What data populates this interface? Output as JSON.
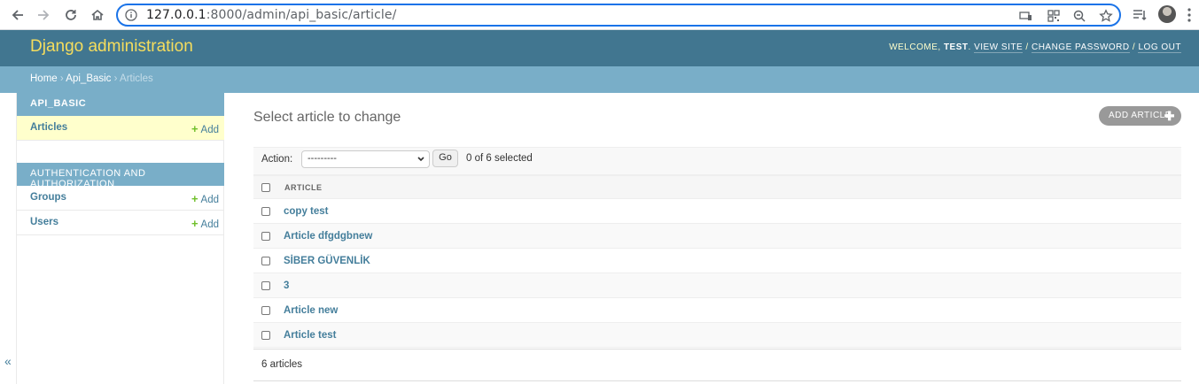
{
  "browser": {
    "url_host": "127.0.0.1",
    "url_rest": ":8000/admin/api_basic/article/"
  },
  "header": {
    "brand": "Django administration",
    "welcome": "WELCOME,",
    "username": "TEST",
    "view_site": "VIEW SITE",
    "change_password": "CHANGE PASSWORD",
    "log_out": "LOG OUT",
    "separator": "/"
  },
  "breadcrumbs": {
    "home": "Home",
    "app": "Api_Basic",
    "current": "Articles",
    "sep": "›"
  },
  "sidebar": {
    "apps": [
      {
        "caption": "API_BASIC",
        "models": [
          {
            "name": "Articles",
            "add": "Add"
          }
        ]
      },
      {
        "caption": "AUTHENTICATION AND AUTHORIZATION",
        "models": [
          {
            "name": "Groups",
            "add": "Add"
          },
          {
            "name": "Users",
            "add": "Add"
          }
        ]
      }
    ],
    "collapse": "«"
  },
  "main": {
    "title": "Select article to change",
    "add_button": "ADD ARTICLE",
    "actions": {
      "label": "Action:",
      "selected": "---------",
      "go": "Go",
      "counter": "0 of 6 selected"
    },
    "table": {
      "column": "ARTICLE",
      "rows": [
        "copy test",
        "Article dfgdgbnew",
        "SİBER GÜVENLİK",
        "3",
        "Article new",
        "Article test"
      ]
    },
    "paginator": "6 articles"
  },
  "colors": {
    "header_bg": "#417690",
    "brand": "#f5dd5d",
    "breadcrumb_bg": "#79aec8",
    "link": "#447e9b",
    "add_green": "#70bf2b",
    "current_model_bg": "#ffffcc"
  }
}
